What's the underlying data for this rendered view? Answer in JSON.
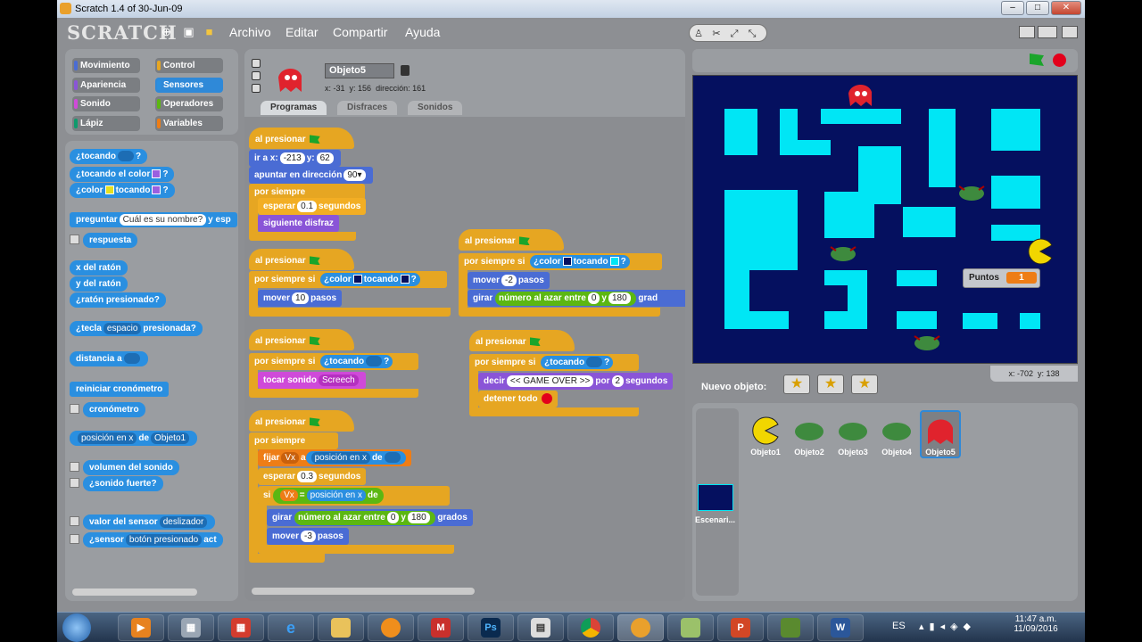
{
  "window": {
    "title": "Scratch 1.4 of 30-Jun-09"
  },
  "menu": {
    "logo": "SCRATCH",
    "items": [
      "Archivo",
      "Editar",
      "Compartir",
      "Ayuda"
    ]
  },
  "categories": {
    "movimiento": "Movimiento",
    "control": "Control",
    "apariencia": "Apariencia",
    "sensores": "Sensores",
    "sonido": "Sonido",
    "operadores": "Operadores",
    "lapiz": "Lápiz",
    "variables": "Variables"
  },
  "palette": {
    "tocando": "¿tocando",
    "tocando_color": "¿tocando el color",
    "color_a": "¿color",
    "color_tocando": "tocando",
    "q": "?",
    "preguntar": "preguntar",
    "preguntar_val": "Cuál es su nombre?",
    "preguntar_tail": "y esp",
    "respuesta": "respuesta",
    "x_raton": "x del ratón",
    "y_raton": "y del ratón",
    "raton_presionado": "¿ratón presionado?",
    "tecla": "¿tecla",
    "tecla_val": "espacio",
    "tecla_tail": "presionada?",
    "distancia": "distancia a",
    "reiniciar": "reiniciar cronómetro",
    "cronometro": "cronómetro",
    "posicion": "posición en x",
    "de": "de",
    "objeto1": "Objeto1",
    "volumen": "volumen del sonido",
    "sonido_fuerte": "¿sonido fuerte?",
    "valor_sensor": "valor del sensor",
    "deslizador": "deslizador",
    "sensor": "¿sensor",
    "boton": "botón presionado",
    "act": "act"
  },
  "sprite": {
    "name": "Objeto5",
    "x_label": "x: -31",
    "y_label": "y: 156",
    "dir_label": "dirección: 161"
  },
  "tabs": {
    "programas": "Programas",
    "disfraces": "Disfraces",
    "sonidos": "Sonidos"
  },
  "scripts": {
    "al_presionar": "al presionar",
    "ir_a": "ir a x:",
    "x_val": "-213",
    "y_lbl": "y:",
    "y_val": "62",
    "apuntar": "apuntar en dirección",
    "dir_val": "90▾",
    "por_siempre": "por siempre",
    "esperar": "esperar",
    "segundos": "segundos",
    "esp1": "0.1",
    "esp2": "0.3",
    "siguiente_disfraz": "siguiente disfraz",
    "por_siempre_si": "por siempre si",
    "color": "¿color",
    "tocando": "tocando",
    "q": "?",
    "mover": "mover",
    "pasos": "pasos",
    "mover1": "10",
    "mover2": "-2",
    "mover3": "-3",
    "tocando_q": "¿tocando",
    "tocar_sonido": "tocar sonido",
    "sonido_val": "Screech",
    "girar": "girar",
    "numero_azar": "número al azar entre",
    "y": "y",
    "az_a": "0",
    "az_b": "180",
    "grados": "grados",
    "grad_trunc": "grad",
    "decir": "decir",
    "decir_val": "<< GAME OVER >>",
    "por": "por",
    "decir_seg": "2",
    "detener_todo": "detener todo",
    "fijar": "fijar",
    "fijar_var": "Vx",
    "a": "a",
    "posicion": "posición en x",
    "de": "de",
    "si": "si",
    "eq": "="
  },
  "stage": {
    "score_label": "Puntos",
    "score_value": "1",
    "mouse_x": "x: -702",
    "mouse_y": "y: 138",
    "nuevo_objeto": "Nuevo objeto:"
  },
  "sprites": [
    "Objeto1",
    "Objeto2",
    "Objeto3",
    "Objeto4",
    "Objeto5"
  ],
  "escenario": "Escenari...",
  "taskbar": {
    "lang": "ES",
    "time": "11:47 a.m.",
    "date": "11/09/2016"
  },
  "colors": {
    "stage_bg": "#05105f",
    "wall": "#00e6f5",
    "control": "#e6a622",
    "sensing": "#2a8fe0"
  }
}
